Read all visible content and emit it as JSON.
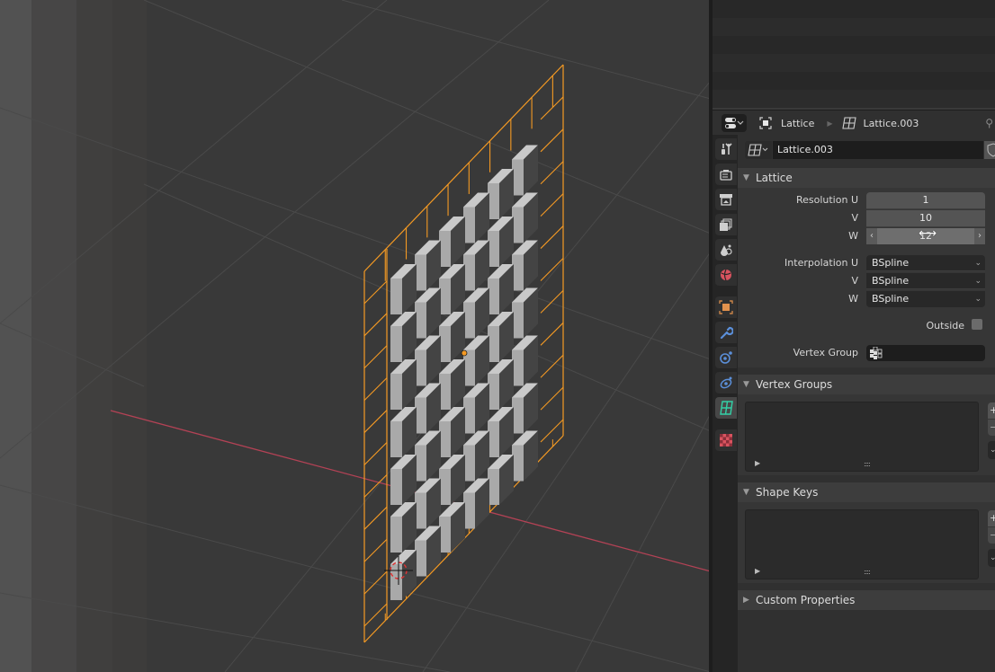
{
  "viewport": {
    "description": "3D viewport showing a lattice object wrapped around a grid of beveled cubes",
    "lattice_color": "#f59a23",
    "x_axis_color": "#b34255",
    "grid_color": "#4a4a4a",
    "object_origin_color": "#f59a23"
  },
  "outliner": {
    "rows": 6
  },
  "properties": {
    "header": {
      "editor_icon": "properties-editor-icon",
      "breadcrumb_object": "Lattice",
      "breadcrumb_object_icon": "object-icon",
      "breadcrumb_data": "Lattice.003",
      "breadcrumb_data_icon": "lattice-data-icon",
      "pin_icon": "pin-icon"
    },
    "tabs": [
      {
        "name": "tool",
        "icon": "tool-icon",
        "color": "#cfcfcf"
      },
      {
        "name": "render",
        "icon": "render-icon",
        "color": "#cfcfcf"
      },
      {
        "name": "output",
        "icon": "output-icon",
        "color": "#cfcfcf"
      },
      {
        "name": "view-layer",
        "icon": "view-layer-icon",
        "color": "#cfcfcf"
      },
      {
        "name": "scene",
        "icon": "scene-icon",
        "color": "#cfcfcf"
      },
      {
        "name": "world",
        "icon": "world-icon",
        "color": "#d9535f"
      },
      {
        "name": "object",
        "icon": "object-icon",
        "color": "#e2924d"
      },
      {
        "name": "modifiers",
        "icon": "wrench-icon",
        "color": "#5b8fd9"
      },
      {
        "name": "particles",
        "icon": "particles-icon",
        "color": "#5b8fd9"
      },
      {
        "name": "physics",
        "icon": "physics-icon",
        "color": "#5b8fd9"
      },
      {
        "name": "lattice-data",
        "icon": "lattice-data-icon",
        "color": "#33d1a7",
        "active": true
      },
      {
        "name": "texture",
        "icon": "texture-icon",
        "color": "#d9535f"
      }
    ],
    "datablock": {
      "name": "Lattice.003",
      "icon": "lattice-data-icon",
      "fake_user_icon": "shield-icon"
    },
    "lattice_panel": {
      "title": "Lattice",
      "resolution_u_label": "Resolution U",
      "resolution_u": "1",
      "resolution_v_label": "V",
      "resolution_v": "10",
      "resolution_w_label": "W",
      "resolution_w": "12",
      "interpolation_u_label": "Interpolation U",
      "interpolation_u": "BSpline",
      "interpolation_v_label": "V",
      "interpolation_v": "BSpline",
      "interpolation_w_label": "W",
      "interpolation_w": "BSpline",
      "outside_label": "Outside",
      "outside_checked": false,
      "vertex_group_label": "Vertex Group",
      "vertex_group_value": ""
    },
    "vertex_groups_panel": {
      "title": "Vertex Groups",
      "add": "+",
      "remove": "−",
      "grip": "::::"
    },
    "shape_keys_panel": {
      "title": "Shape Keys",
      "add": "+",
      "remove": "−",
      "grip": "::::"
    },
    "custom_properties_panel": {
      "title": "Custom Properties"
    }
  }
}
